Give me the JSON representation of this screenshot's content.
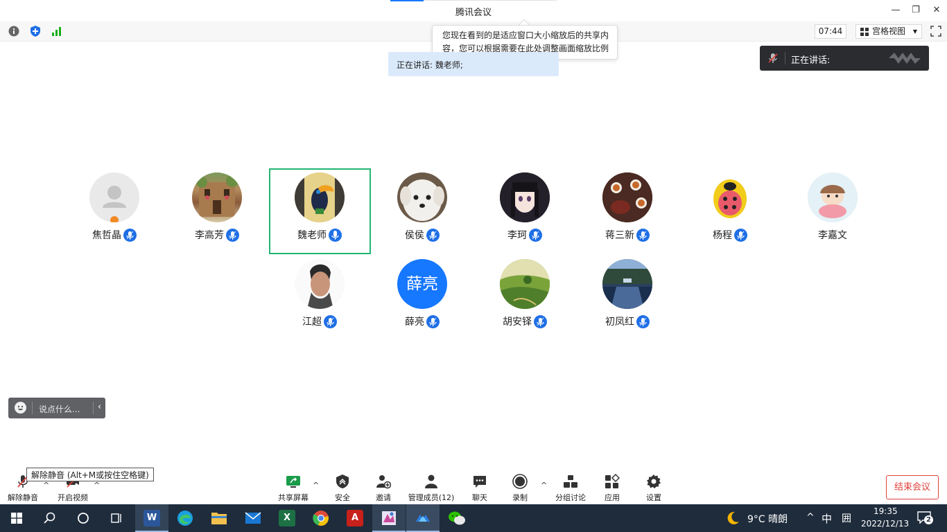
{
  "window": {
    "title": "腾讯会议",
    "minimize_glyph": "—",
    "restore_glyph": "❐",
    "close_glyph": "✕"
  },
  "toolbar": {
    "meeting_time": "07:44",
    "view_mode": "宫格视图",
    "view_caret": "▼"
  },
  "callout": {
    "line1": "您现在看到的是适应窗口大小缩放后的共享内",
    "line2": "容，您可以根据需要在此处调整画面缩放比例"
  },
  "speaking_banner": "正在讲话: 魏老师;",
  "speaker_panel": {
    "label": "正在讲话:"
  },
  "participants": [
    {
      "name": "焦哲晶",
      "mic": "muted-blue",
      "avatar": "default-user-icon"
    },
    {
      "name": "李高芳",
      "mic": "muted-blue",
      "avatar": "building-photo"
    },
    {
      "name": "魏老师",
      "mic": "active-blue",
      "avatar": "toucan-painting",
      "active": true
    },
    {
      "name": "侯侯",
      "mic": "muted-blue",
      "avatar": "white-puppy-photo"
    },
    {
      "name": "李珂",
      "mic": "muted-blue",
      "avatar": "anime-girl"
    },
    {
      "name": "蒋三新",
      "mic": "muted-blue",
      "avatar": "tea-cups-photo"
    },
    {
      "name": "杨程",
      "mic": "muted-blue",
      "avatar": "ladybug-cartoon"
    },
    {
      "name": "李嘉文",
      "mic": "none",
      "avatar": "cartoon-girl"
    },
    {
      "name": "江超",
      "mic": "muted-blue",
      "avatar": "man-portrait"
    },
    {
      "name": "薛亮",
      "mic": "muted-blue",
      "avatar": "text-avatar",
      "avatar_text": "薛亮"
    },
    {
      "name": "胡安铎",
      "mic": "muted-blue",
      "avatar": "green-hills-photo"
    },
    {
      "name": "初凤红",
      "mic": "muted-blue",
      "avatar": "river-photo"
    }
  ],
  "chat": {
    "placeholder": "说点什么...",
    "collapse_glyph": "‹"
  },
  "bottom_toolbar": {
    "unmute": "解除静音",
    "unmute_tooltip": "解除静音 (Alt+M或按住空格键)",
    "start_video": "开启视频",
    "share_screen": "共享屏幕",
    "security": "安全",
    "invite": "邀请",
    "manage_members": "管理成员(12)",
    "chat": "聊天",
    "record": "录制",
    "breakout": "分组讨论",
    "apps": "应用",
    "settings": "设置",
    "end_meeting": "结束会议",
    "caret": "^"
  },
  "taskbar": {
    "apps": [
      "start",
      "search",
      "cortana",
      "task-view",
      "word",
      "edge",
      "file-explorer",
      "mail",
      "excel",
      "chrome",
      "acrobat",
      "paint",
      "tencent-meeting",
      "wechat"
    ],
    "word_glyph": "W",
    "excel_glyph": "X",
    "acrobat_glyph": "A",
    "weather": "9°C  晴朗",
    "ime_lang": "中",
    "ime_mode": "囲",
    "tray_caret": "^",
    "time": "19:35",
    "date": "2022/12/13",
    "notifications": "2"
  },
  "colors": {
    "accent": "#1677ff",
    "active_border": "#22b573",
    "end_meeting": "#e0413a",
    "taskbar": "#1f2c3c"
  }
}
